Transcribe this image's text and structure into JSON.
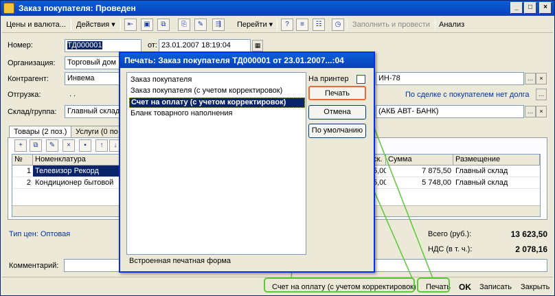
{
  "window": {
    "title": "Заказ покупателя: Проведен",
    "controls": [
      "_",
      "□",
      "×"
    ]
  },
  "toolbar": {
    "prices_label": "Цены и валюта...",
    "actions_label": "Действия ▾",
    "goto_label": "Перейти ▾",
    "fill_post_label": "Заполнить и провести",
    "analysis_label": "Анализ",
    "help_glyph": "?"
  },
  "form": {
    "number_label": "Номер:",
    "number_value": "ТД000001",
    "from_label": "от:",
    "date_value": "23.01.2007 18:19:04",
    "org_label": "Организация:",
    "org_value": "Торговый дом",
    "contractor_label": "Контрагент:",
    "contractor_value": "Инвема",
    "contract_value_tail": "ИН-78",
    "shipment_label": "Отгрузка:",
    "shipment_value": ". .",
    "deal_link": "По сделке с покупателем нет долга",
    "warehouse_label": "Склад/группа:",
    "warehouse_value": "Главный склад",
    "bank_value_tail": "(АКБ АВТ- БАНК)"
  },
  "tabs": [
    {
      "label": "Товары (2 поз.)"
    },
    {
      "label": "Услуги (0 по"
    }
  ],
  "grid": {
    "headers": [
      "№",
      "Номенклатура",
      "ск.",
      "Сумма",
      "Размещение"
    ],
    "rows": [
      {
        "n": "1",
        "name": "Телевизор Рекорд",
        "disc": "5,00",
        "sum": "7 875,50",
        "place": "Главный склад"
      },
      {
        "n": "2",
        "name": "Кондиционер бытовой",
        "disc": "5,00",
        "sum": "5 748,00",
        "place": "Главный склад"
      }
    ]
  },
  "totals": {
    "price_type": "Тип цен: Оптовая",
    "total_label": "Всего (руб.):",
    "total_value": "13 623,50",
    "vat_label": "НДС (в т. ч.):",
    "vat_value": "2 078,16"
  },
  "comment_label": "Комментарий:",
  "bottom_bar": {
    "form_name": "Счет на оплату (с учетом корректировок)",
    "print": "Печать",
    "ok": "OK",
    "save": "Записать",
    "close": "Закрыть"
  },
  "dialog": {
    "title": "Печать: Заказ покупателя ТД000001 от 23.01.2007...:04",
    "items": [
      "Заказ покупателя",
      "Заказ покупателя (с учетом корректировок)",
      "Счет на оплату (с учетом корректировок)",
      "Бланк товарного наполнения"
    ],
    "selected_index": 2,
    "to_printer_label": "На принтер",
    "print_button": "Печать",
    "cancel_button": "Отмена",
    "default_button": "По умолчанию",
    "status_text": "Встроенная печатная форма"
  },
  "colors": {
    "highlight": "#5ec63a",
    "accent_title": "#0a5fd8",
    "selected_row": "#0a246a"
  }
}
